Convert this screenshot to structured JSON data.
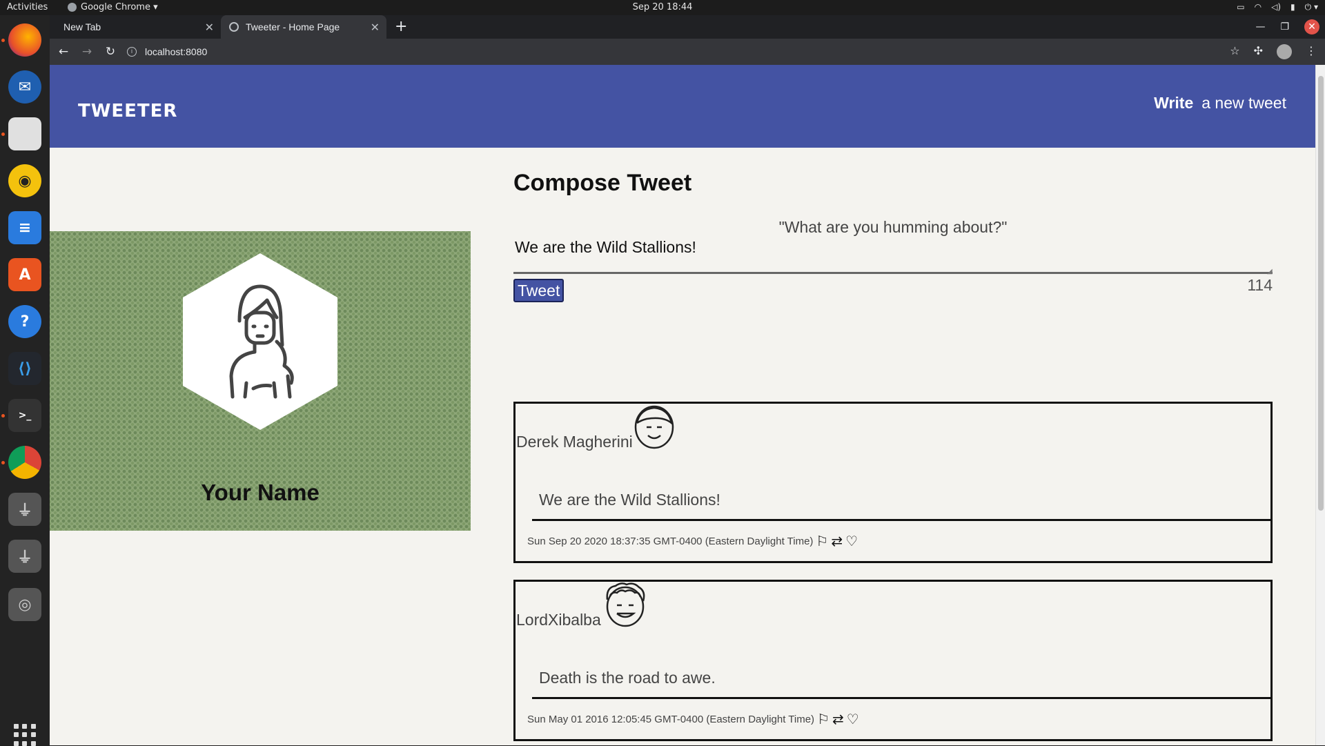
{
  "os": {
    "activities": "Activities",
    "app_name": "Google Chrome ▾",
    "clock": "Sep 20  18:44"
  },
  "browser": {
    "tabs": [
      {
        "label": "New Tab"
      },
      {
        "label": "Tweeter - Home Page"
      }
    ],
    "url": "localhost:8080"
  },
  "header": {
    "brand": "TWEETER",
    "write_bold": "Write",
    "write_rest": "a new tweet"
  },
  "profile": {
    "name": "Your Name"
  },
  "compose": {
    "title": "Compose Tweet",
    "prompt": "\"What are you humming about?\"",
    "text": "We are the Wild Stallions!",
    "button": "Tweet",
    "counter": "114"
  },
  "tweets": [
    {
      "author": "Derek Magherini",
      "content": "We are the Wild Stallions!",
      "timestamp": "Sun Sep 20 2020 18:37:35 GMT-0400 (Eastern Daylight Time)"
    },
    {
      "author": "LordXibalba",
      "content": "Death is the road to awe.",
      "timestamp": "Sun May 01 2016 12:05:45 GMT-0400 (Eastern Daylight Time)"
    }
  ],
  "icons": {
    "flag": "flag-icon",
    "retweet": "retweet-icon",
    "like": "heart-icon"
  },
  "colors": {
    "header_bg": "#4453a3",
    "page_bg": "#f4f3ef",
    "profile_bg": "#8fa879"
  }
}
